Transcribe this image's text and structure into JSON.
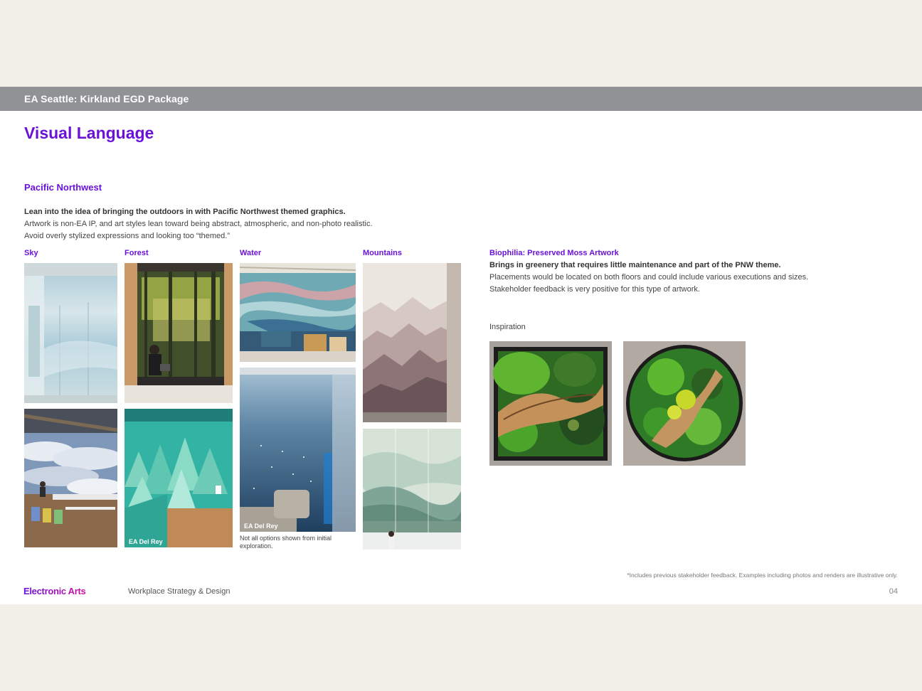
{
  "header": {
    "title": "EA Seattle: Kirkland EGD Package"
  },
  "page_title": "Visual Language",
  "section_title": "Pacific Northwest",
  "intro": {
    "bold": "Lean into the idea of bringing the outdoors in with Pacific Northwest themed graphics.",
    "lines": [
      "Artwork is non-EA IP, and art styles lean toward being abstract, atmospheric, and non-photo realistic.",
      "Avoid overly stylized expressions and looking too “themed.”"
    ]
  },
  "categories": [
    "Sky",
    "Forest",
    "Water",
    "Mountains"
  ],
  "photo_labels": {
    "forest_2": "EA Del Rey",
    "water_2": "EA Del Rey"
  },
  "water_note": "Not all options shown from initial exploration.",
  "biophilia": {
    "title": "Biophilia: Preserved Moss Artwork",
    "bold": "Brings in greenery that requires little maintenance and part of the PNW theme.",
    "lines": [
      "Placements would be located on both floors and could include various executions and sizes.",
      "Stakeholder feedback is very positive for this type of artwork."
    ],
    "inspiration_label": "Inspiration"
  },
  "footer": {
    "footnote": "*Includes previous stakeholder feedback. Examples including photos and renders are illustrative only.",
    "brand": "Electronic Arts",
    "department": "Workplace Strategy & Design",
    "page_number": "04"
  },
  "colors": {
    "accent": "#6b12d9",
    "header_bar": "#909295",
    "page_bg": "#f2efe8"
  },
  "images": [
    "sky-atrium-photo",
    "sky-cafeteria-mural-photo",
    "forest-nook-mural-photo",
    "forest-teal-trees-mural-photo",
    "water-lounge-mural-photo",
    "water-blue-wall-photo",
    "mountains-mural-photo",
    "mountains-misty-glass-photo",
    "moss-square-artwork-photo",
    "moss-round-artwork-photo"
  ]
}
